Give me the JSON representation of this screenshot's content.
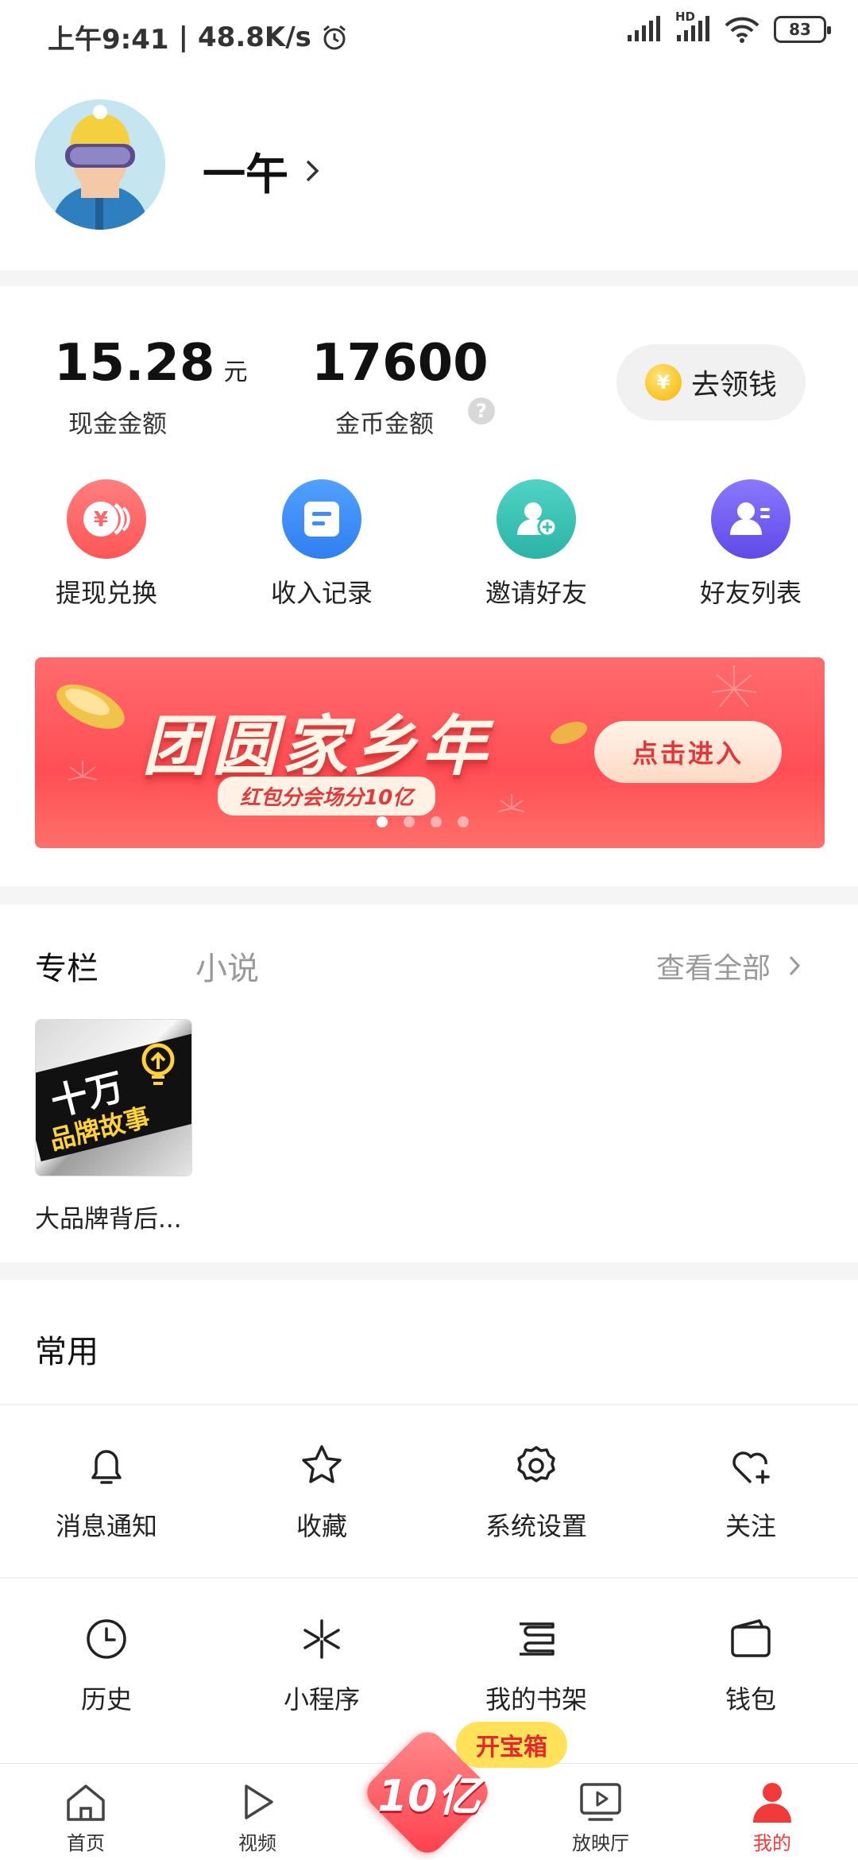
{
  "status_bar": {
    "time": "上午9:41",
    "speed": "48.8K/s",
    "battery": "83",
    "hd": "HD"
  },
  "profile": {
    "name": "一午"
  },
  "wallet": {
    "cash_value": "15.28",
    "cash_unit": "元",
    "cash_label": "现金金额",
    "coin_value": "17600",
    "coin_label": "金币金额",
    "help": "?",
    "get_money": "去领钱",
    "coin_symbol": "¥"
  },
  "quick_actions": [
    {
      "label": "提现兑换",
      "icon": "withdraw-icon",
      "color": "#ff6464",
      "glyph": "¥"
    },
    {
      "label": "收入记录",
      "icon": "income-record-icon",
      "color": "#3d8df5"
    },
    {
      "label": "邀请好友",
      "icon": "invite-friend-icon",
      "color": "#36c2b4"
    },
    {
      "label": "好友列表",
      "icon": "friend-list-icon",
      "color": "#6f5cf0"
    }
  ],
  "banner": {
    "title": "团圆家乡年",
    "subtitle": "红包分会场分10亿",
    "button": "点击进入",
    "page_count": 4,
    "active_page": 1
  },
  "columns": {
    "tabs": [
      "专栏",
      "小说"
    ],
    "view_all": "查看全部",
    "items": [
      {
        "title": "大品牌背后...",
        "cover_top": "十万",
        "cover_bottom": "品牌故事"
      }
    ]
  },
  "common": {
    "title": "常用",
    "tools": [
      {
        "label": "消息通知",
        "icon": "bell-icon"
      },
      {
        "label": "收藏",
        "icon": "star-icon"
      },
      {
        "label": "系统设置",
        "icon": "gear-icon"
      },
      {
        "label": "关注",
        "icon": "heart-plus-icon"
      },
      {
        "label": "历史",
        "icon": "clock-icon"
      },
      {
        "label": "小程序",
        "icon": "mini-program-icon"
      },
      {
        "label": "我的书架",
        "icon": "bookshelf-icon"
      },
      {
        "label": "钱包",
        "icon": "wallet-icon"
      }
    ]
  },
  "bottom_nav": {
    "items": [
      {
        "label": "首页",
        "icon": "home-icon"
      },
      {
        "label": "视频",
        "icon": "play-icon"
      },
      {
        "label": "放映厅",
        "icon": "screening-hall-icon"
      },
      {
        "label": "我的",
        "icon": "person-icon",
        "active": true
      }
    ],
    "treasure_label": "开宝箱",
    "center_label": "10亿"
  },
  "colors": {
    "accent": "#ff3b3b",
    "active_nav": "#f23a3a"
  }
}
